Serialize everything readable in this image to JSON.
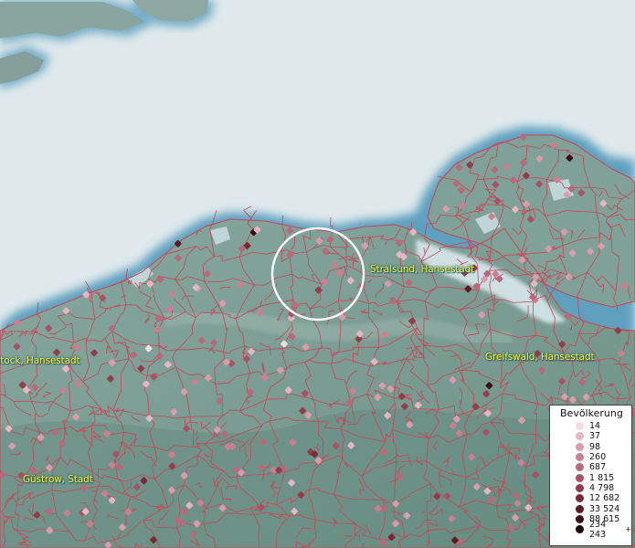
{
  "map": {
    "legend": {
      "title": "Bevölkerung",
      "entries": [
        {
          "label": "14",
          "color": "#f1dde3"
        },
        {
          "label": "37",
          "color": "#e2b6c3"
        },
        {
          "label": "98",
          "color": "#d79dad"
        },
        {
          "label": "260",
          "color": "#c98192"
        },
        {
          "label": "687",
          "color": "#b66a7a"
        },
        {
          "label": "1 815",
          "color": "#a65465"
        },
        {
          "label": "4 798",
          "color": "#903e4c"
        },
        {
          "label": "12 682",
          "color": "#782b36"
        },
        {
          "label": "33 524",
          "color": "#5c1a23"
        },
        {
          "label": "88 615",
          "color": "#3d0c12"
        },
        {
          "label": "234 243",
          "color": "#1c0306",
          "suffix": "+"
        }
      ]
    },
    "cities": [
      {
        "id": "stralsund",
        "name": "Stralsund, Hansestadt"
      },
      {
        "id": "rostock",
        "name": "Rostock, Hansestadt"
      },
      {
        "id": "greifswald",
        "name": "Greifswald, Hansestadt"
      },
      {
        "id": "guestrow",
        "name": "Güstrow, Stadt"
      }
    ],
    "colors": {
      "sea": "#dfe9ec",
      "land": "#7c9e93",
      "coast_glow": "#4a94b8",
      "boundary": "#c9455a",
      "focus_ring": "#ffffff",
      "label": "#f3f24a"
    }
  }
}
